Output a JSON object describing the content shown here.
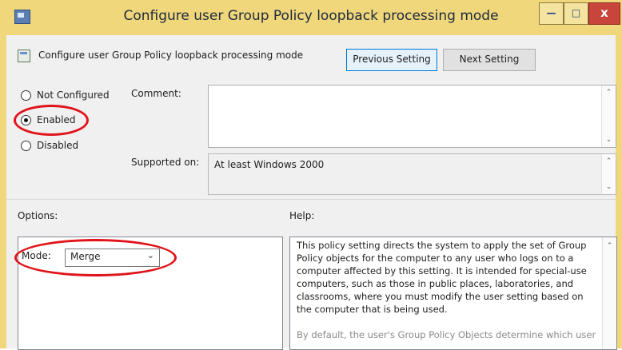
{
  "window": {
    "title": "Configure user Group Policy loopback processing mode",
    "min_glyph": "—",
    "max_glyph": "□",
    "close_glyph": "x"
  },
  "header": {
    "setting_name": "Configure user Group Policy loopback processing mode",
    "previous_label": "Previous Setting",
    "next_label": "Next Setting"
  },
  "state": {
    "options": [
      {
        "label": "Not Configured",
        "selected": false
      },
      {
        "label": "Enabled",
        "selected": true
      },
      {
        "label": "Disabled",
        "selected": false
      }
    ]
  },
  "comment": {
    "label": "Comment:",
    "value": ""
  },
  "supported": {
    "label": "Supported on:",
    "value": "At least Windows 2000"
  },
  "options_section": {
    "label": "Options:",
    "mode_label": "Mode:",
    "mode_value": "Merge"
  },
  "help_section": {
    "label": "Help:",
    "paragraph1": "This policy setting directs the system to apply the set of Group Policy objects for the computer to any user who logs on to a computer affected by this setting. It is intended for special-use computers, such as those in public places, laboratories, and classrooms, where you must modify the user setting based on the computer that is being used.",
    "paragraph2": "By default, the user's Group Policy Objects determine which user"
  },
  "annotation_color": "#e0141a",
  "icons": [
    "app-icon",
    "policy-icon",
    "chevron-down-icon",
    "scroll-up-arrow-icon",
    "scroll-down-arrow-icon"
  ]
}
